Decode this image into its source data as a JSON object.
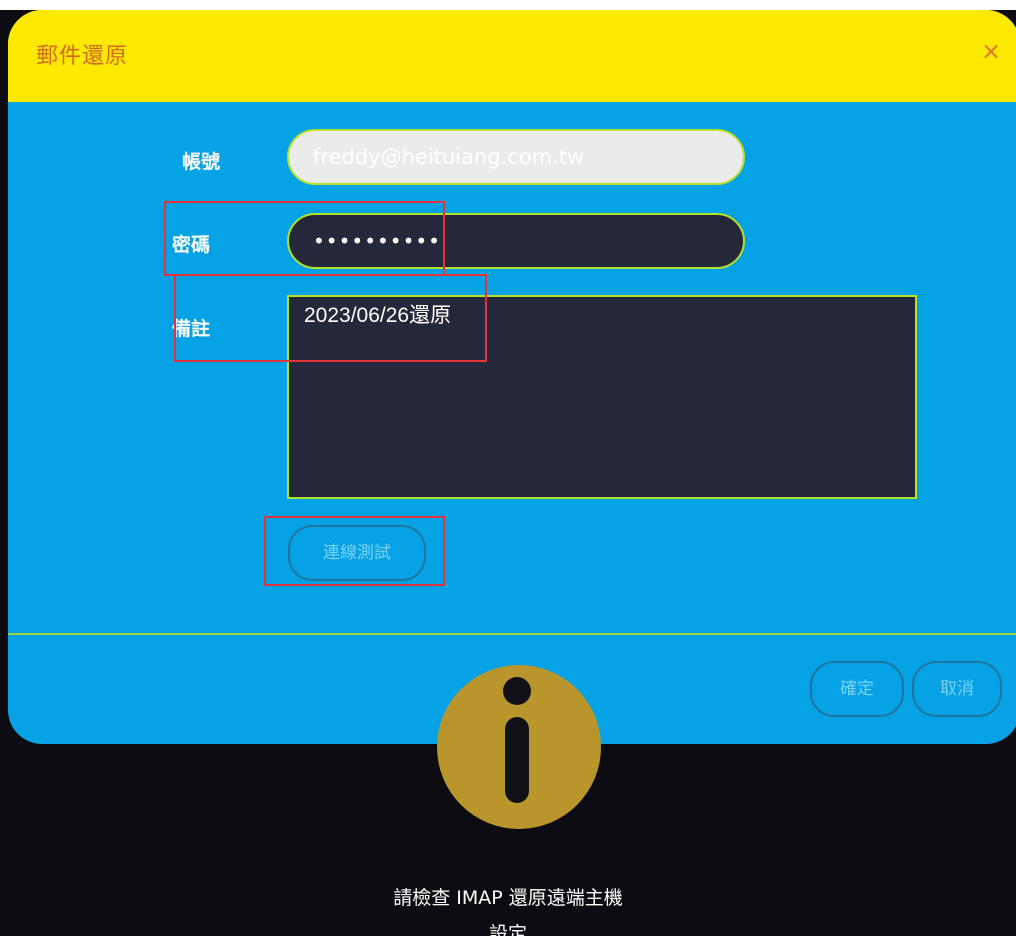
{
  "dialog": {
    "title": "郵件還原",
    "close_label": "×",
    "account": {
      "label": "帳號",
      "value": "freddy@heituiang.com.tw"
    },
    "password": {
      "label": "密碼",
      "value": "••••••••••"
    },
    "note": {
      "label": "備註",
      "value": "2023/06/26還原"
    },
    "test_connection_label": "連線測試",
    "ok_label": "確定",
    "cancel_label": "取消"
  },
  "alert": {
    "icon": "info-icon",
    "message_line1": "請檢查 IMAP 還原遠端主機",
    "message_line2": "設定"
  },
  "colors": {
    "header": "#fde900",
    "body": "#06a2e6",
    "field_border": "#b6e12a",
    "highlight": "#e0333a"
  }
}
